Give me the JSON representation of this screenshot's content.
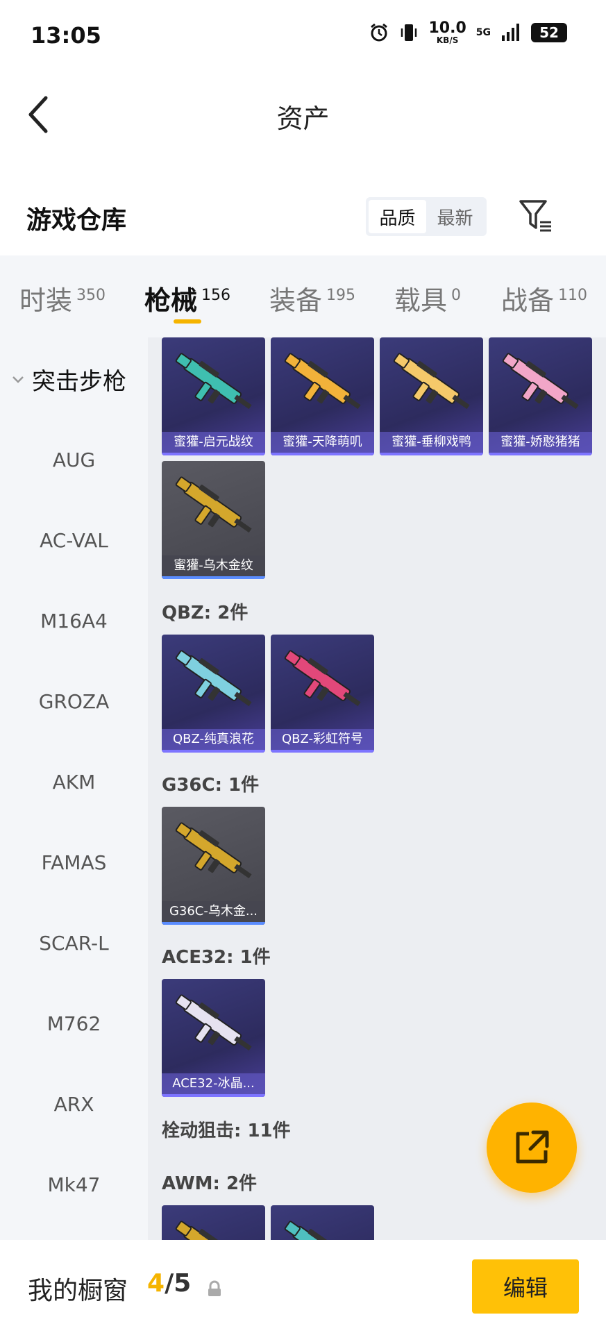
{
  "status_bar": {
    "time": "13:05",
    "speed_value": "10.0",
    "speed_unit": "KB/S",
    "network": "5G",
    "battery": "52"
  },
  "header": {
    "title": "资产"
  },
  "warehouse": {
    "title": "游戏仓库",
    "sort_options": [
      "品质",
      "最新"
    ],
    "active_sort": "品质"
  },
  "tabs": [
    {
      "label": "时装",
      "count": "350"
    },
    {
      "label": "枪械",
      "count": "156"
    },
    {
      "label": "装备",
      "count": "195"
    },
    {
      "label": "载具",
      "count": "0"
    },
    {
      "label": "战备",
      "count": "110"
    }
  ],
  "active_tab": "枪械",
  "sidebar": {
    "group": "突击步枪",
    "items": [
      "AUG",
      "AC-VAL",
      "M16A4",
      "GROZA",
      "AKM",
      "FAMAS",
      "SCAR-L",
      "M762",
      "ARX",
      "Mk47"
    ]
  },
  "content": {
    "top_cards": [
      {
        "name": "蜜獾-启元战纹",
        "style": "purple",
        "gun_color": "#3fbfb0"
      },
      {
        "name": "蜜獾-天降萌叽",
        "style": "purple",
        "gun_color": "#f2b23a"
      },
      {
        "name": "蜜獾-垂柳戏鸭",
        "style": "purple",
        "gun_color": "#f5c96a"
      },
      {
        "name": "蜜獾-娇憨猪猪",
        "style": "purple",
        "gun_color": "#f2a6c8"
      },
      {
        "name": "蜜獾-乌木金纹",
        "style": "gray",
        "gun_color": "#d4a72c"
      }
    ],
    "sections": [
      {
        "label": "QBZ: 2件",
        "cards": [
          {
            "name": "QBZ-纯真浪花",
            "style": "purple",
            "gun_color": "#7fd0e0"
          },
          {
            "name": "QBZ-彩虹符号",
            "style": "purple",
            "gun_color": "#e2487a"
          }
        ]
      },
      {
        "label": "G36C: 1件",
        "cards": [
          {
            "name": "G36C-乌木金...",
            "style": "gray",
            "gun_color": "#d4a72c"
          }
        ]
      },
      {
        "label": "ACE32: 1件",
        "cards": [
          {
            "name": "ACE32-冰晶...",
            "style": "purple",
            "gun_color": "#e6e2f0"
          }
        ]
      },
      {
        "label": "栓动狙击: 11件",
        "cards": []
      },
      {
        "label": "AWM: 2件",
        "cards": [
          {
            "name": "",
            "style": "purple",
            "gun_color": "#d4a72c"
          },
          {
            "name": "",
            "style": "purple",
            "gun_color": "#4fc0c0"
          }
        ]
      }
    ]
  },
  "bottom_bar": {
    "title": "我的橱窗",
    "current": "4",
    "separator": "/",
    "total": "5",
    "edit_label": "编辑"
  },
  "colors": {
    "accent": "#f5b400",
    "button": "#ffc107",
    "card_purple": "#2d2b5e",
    "card_gray": "#4a4a52"
  },
  "icons": [
    "back-arrow-icon",
    "filter-icon",
    "chevron-down-icon",
    "lock-icon",
    "share-icon",
    "alarm-icon",
    "vibrate-icon",
    "signal-icon",
    "battery-icon"
  ]
}
